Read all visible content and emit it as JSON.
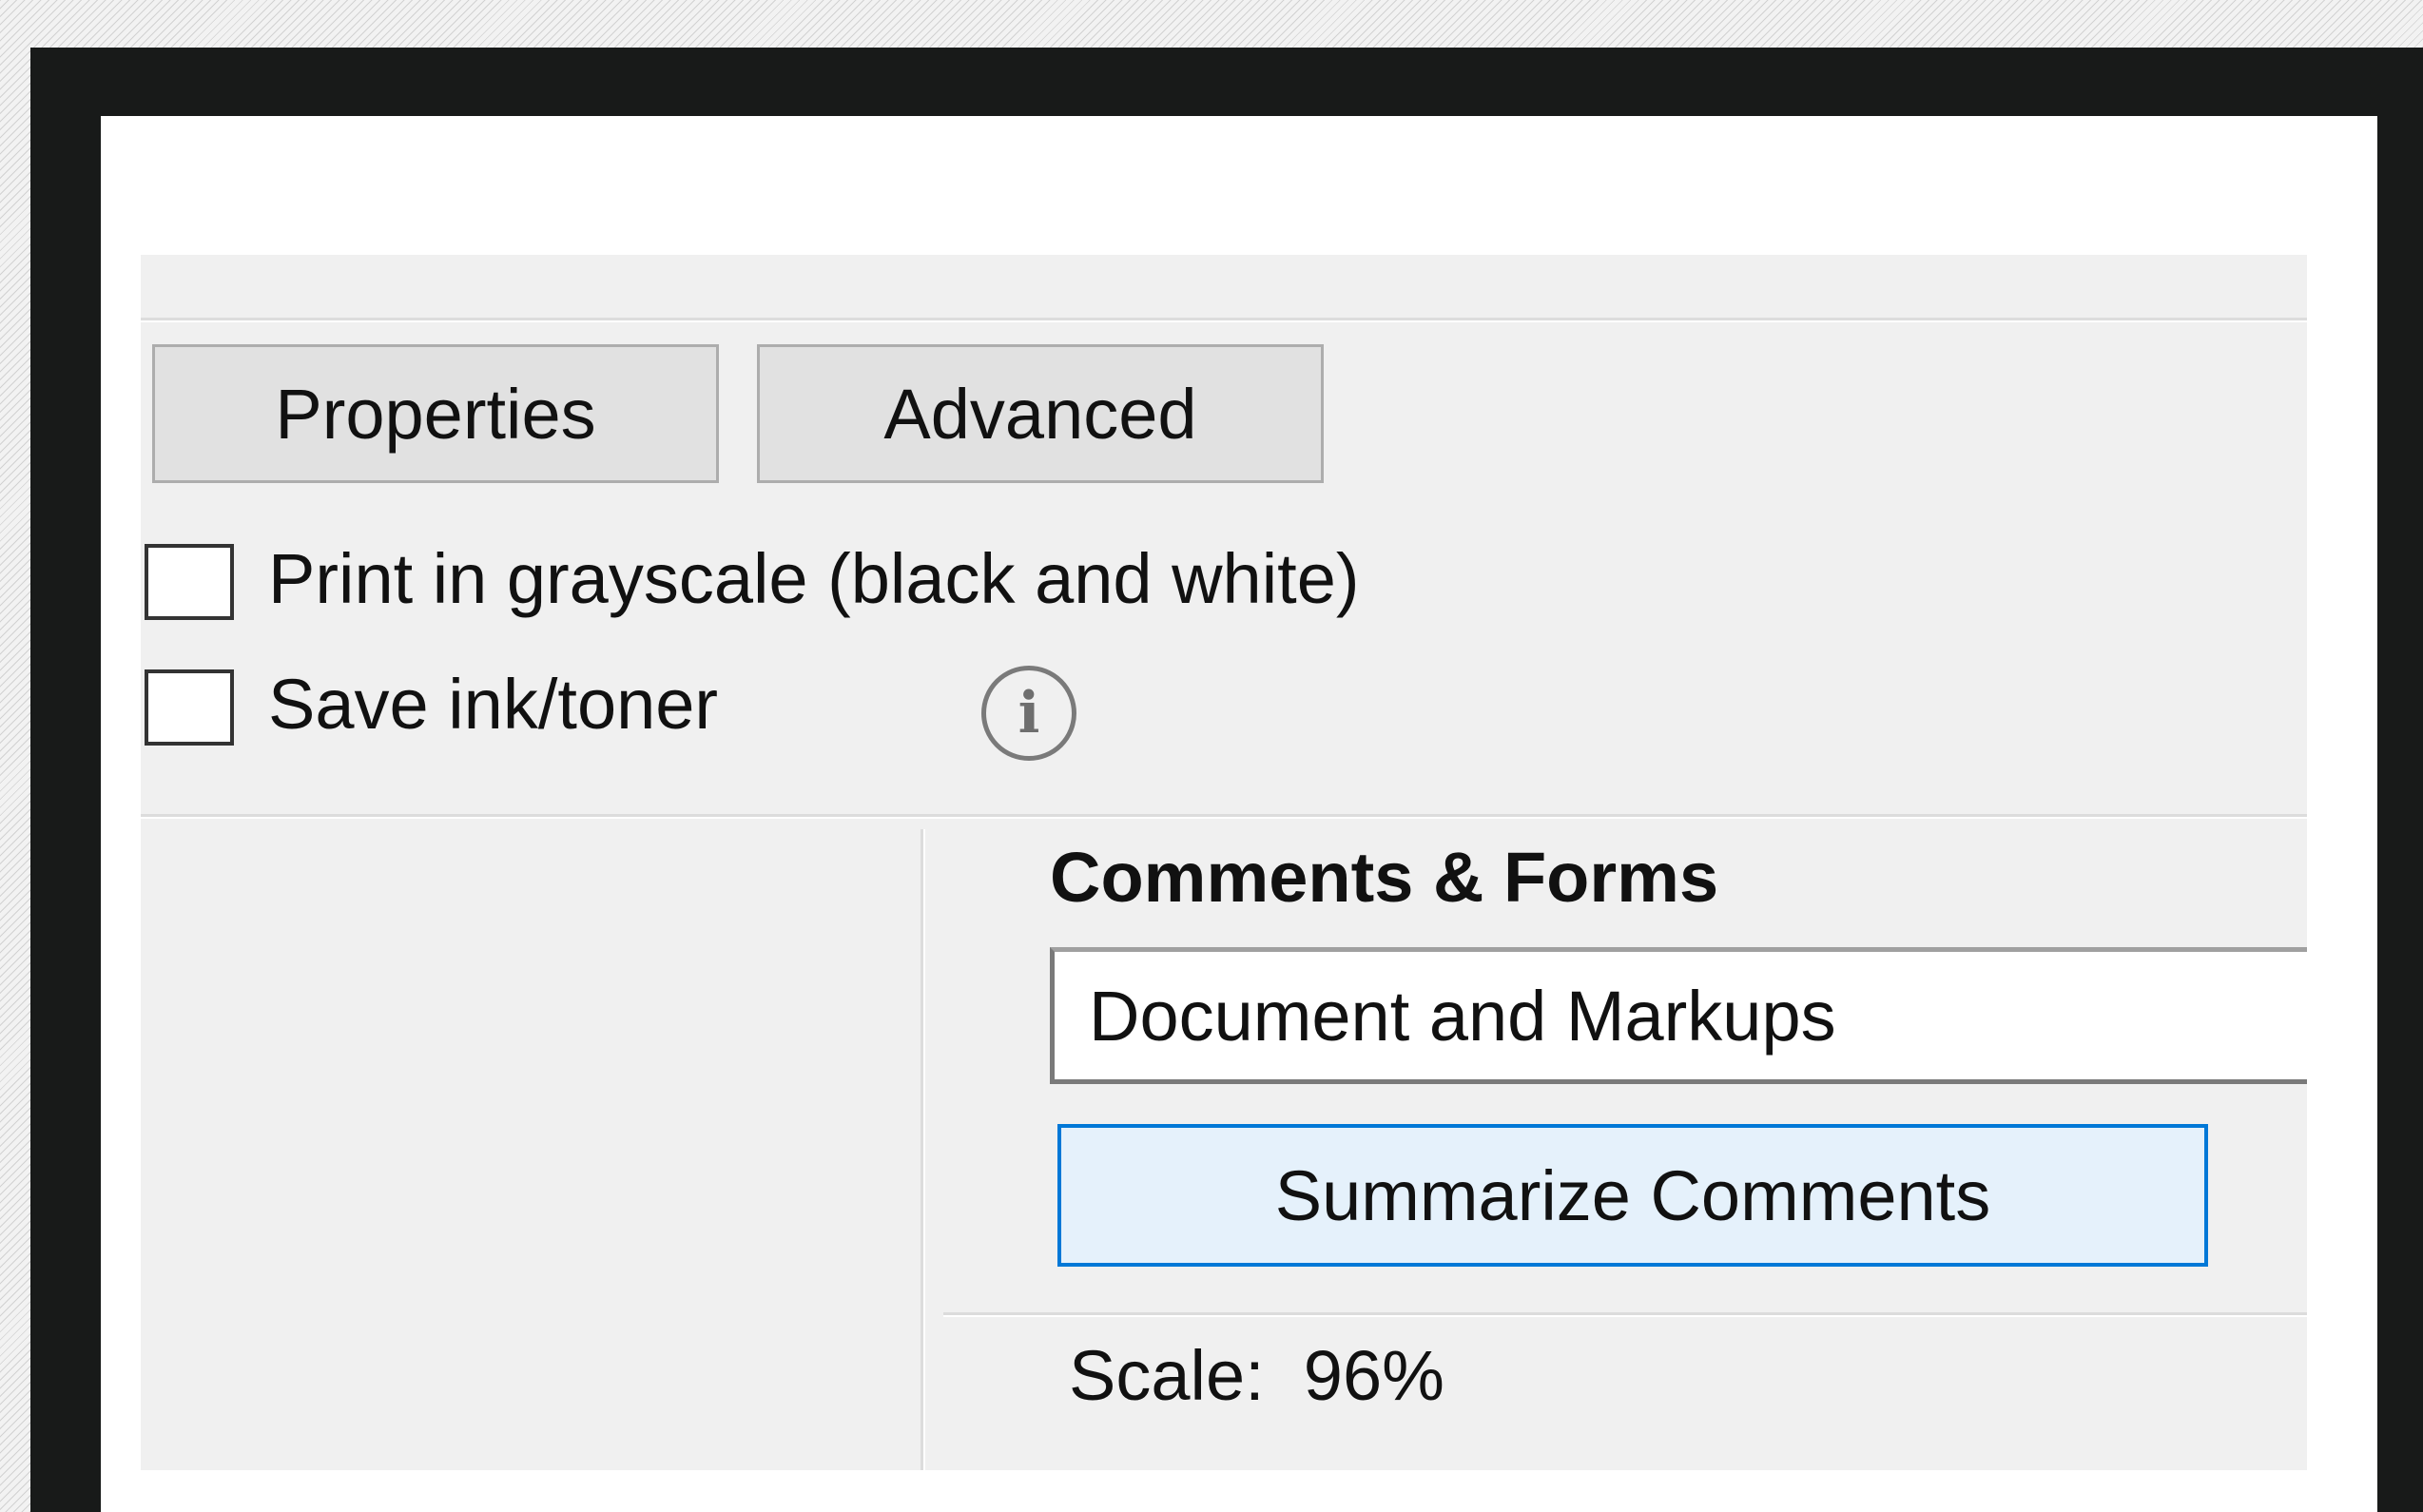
{
  "buttons": {
    "properties": "Properties",
    "advanced": "Advanced",
    "summarize_comments": "Summarize Comments"
  },
  "options": {
    "grayscale": {
      "label": "Print in grayscale (black and white)",
      "checked": false
    },
    "save_ink": {
      "label": "Save ink/toner",
      "checked": false
    }
  },
  "icons": {
    "info": "info-icon"
  },
  "comments_forms": {
    "title": "Comments & Forms",
    "selected": "Document and Markups"
  },
  "scale": {
    "label": "Scale:",
    "value": "96%"
  },
  "colors": {
    "dialog_bg": "#f0f0f0",
    "button_bg": "#e1e1e1",
    "focus_border": "#0078d7",
    "focus_bg": "#e5f1fb"
  }
}
